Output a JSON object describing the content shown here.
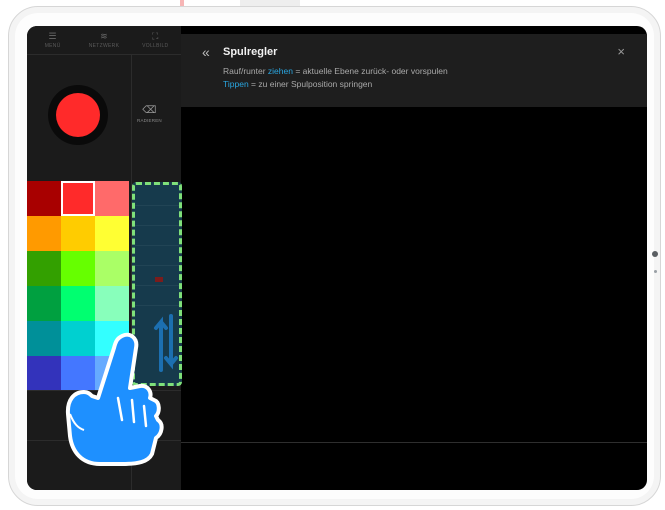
{
  "menu": {
    "items": [
      {
        "label": "MENÜ",
        "icon": "list-icon"
      },
      {
        "label": "NETZWERK",
        "icon": "wifi-icon"
      },
      {
        "label": "VOLLBILD",
        "icon": "fullscreen-icon"
      }
    ]
  },
  "tools": {
    "erase_label": "RADIEREN",
    "middle_label": "",
    "bottom_label": ""
  },
  "palette": {
    "colors": [
      "#a80000",
      "#ff2a2a",
      "#ff6a6a",
      "#ff9a00",
      "#ffcc00",
      "#ffff33",
      "#33a000",
      "#66ff00",
      "#aaff66",
      "#00a040",
      "#00ff70",
      "#88ffbb",
      "#009099",
      "#00d0d0",
      "#33ffff",
      "#3333bb",
      "#4477ff",
      "#66aaff"
    ],
    "selected_index": 1
  },
  "tooltip": {
    "title": "Spulregler",
    "line1_pre": "Rauf/runter ",
    "line1_kw": "ziehen",
    "line1_post": " = aktuelle Ebene zurück- oder vorspulen",
    "line2_kw": "Tippen",
    "line2_post": " = zu einer Spulposition springen"
  },
  "colors": {
    "accent": "#2aa6e0",
    "record": "#ff2a2a",
    "scrubber_highlight": "#7fe07a",
    "hand": "#1e90ff"
  }
}
